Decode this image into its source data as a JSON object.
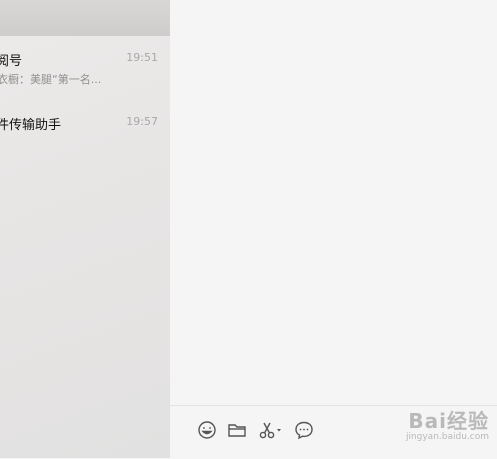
{
  "chat_list": [
    {
      "name": "阅号",
      "time": "19:51",
      "preview": "星衣橱：美腿“第一名..."
    },
    {
      "name": "件传输助手",
      "time": "19:57",
      "preview": ""
    }
  ],
  "toolbar": {
    "icons": [
      "emoji-icon",
      "folder-icon",
      "scissors-icon",
      "chat-bubble-icon"
    ]
  },
  "watermark": {
    "main": "Bai经验",
    "sub": "jingyan.baidu.com"
  },
  "colors": {
    "sidebar_bg": "#e7e5e4",
    "main_bg": "#f5f5f5",
    "icon": "#555555"
  }
}
